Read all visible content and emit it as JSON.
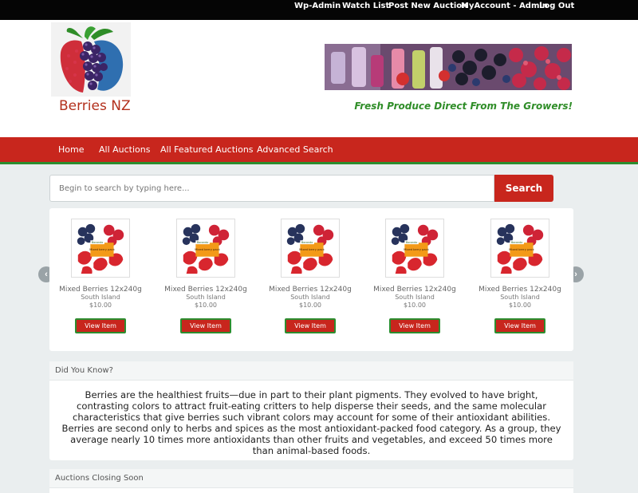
{
  "adminbar": {
    "links": [
      "Wp-Admin",
      "Watch List",
      "Post New Auction",
      "MyAccount - Admin",
      "Log Out"
    ]
  },
  "header": {
    "site_name": "Berries NZ",
    "tagline": "Fresh Produce Direct From The Growers!"
  },
  "nav": {
    "items": [
      "Home",
      "All Auctions",
      "All Featured Auctions",
      "Advanced Search"
    ]
  },
  "search": {
    "placeholder": "Begin to search by typing here...",
    "button": "Search"
  },
  "products": [
    {
      "name": "Mixed Berries 12x240g",
      "location": "South Island",
      "price": "$10.00",
      "button": "View Item",
      "image_label": "Mixed berry pack",
      "brand": "Bocondo"
    },
    {
      "name": "Mixed Berries 12x240g",
      "location": "South Island",
      "price": "$10.00",
      "button": "View Item",
      "image_label": "Mixed berry pack",
      "brand": "Bocondo"
    },
    {
      "name": "Mixed Berries 12x240g",
      "location": "South Island",
      "price": "$10.00",
      "button": "View Item",
      "image_label": "Mixed berry pack",
      "brand": "Bocondo"
    },
    {
      "name": "Mixed Berries 12x240g",
      "location": "South Island",
      "price": "$10.00",
      "button": "View Item",
      "image_label": "Mixed berry pack",
      "brand": "Bocondo"
    },
    {
      "name": "Mixed Berries 12x240g",
      "location": "South Island",
      "price": "$10.00",
      "button": "View Item",
      "image_label": "Mixed berry pack",
      "brand": "Bocondo"
    }
  ],
  "carousel": {
    "prev_icon": "chevron-left-icon",
    "next_icon": "chevron-right-icon"
  },
  "did_you_know": {
    "title": "Did You Know?",
    "body": "Berries are the healthiest fruits—due in part to their plant pigments. They evolved to have bright, contrasting colors to attract fruit-eating critters to help disperse their seeds, and the same molecular characteristics that give berries such vibrant colors may account for some of their antioxidant abilities. Berries are second only to herbs and spices as the most antioxidant-packed food category. As a group, they average nearly 10 times more antioxidants than other fruits and vegetables, and exceed 50 times more than animal-based foods."
  },
  "closing_soon": {
    "title": "Auctions Closing Soon"
  },
  "colors": {
    "brand_red": "#c8261d",
    "brand_green": "#2c8d2f",
    "adminbar": "#050505"
  }
}
